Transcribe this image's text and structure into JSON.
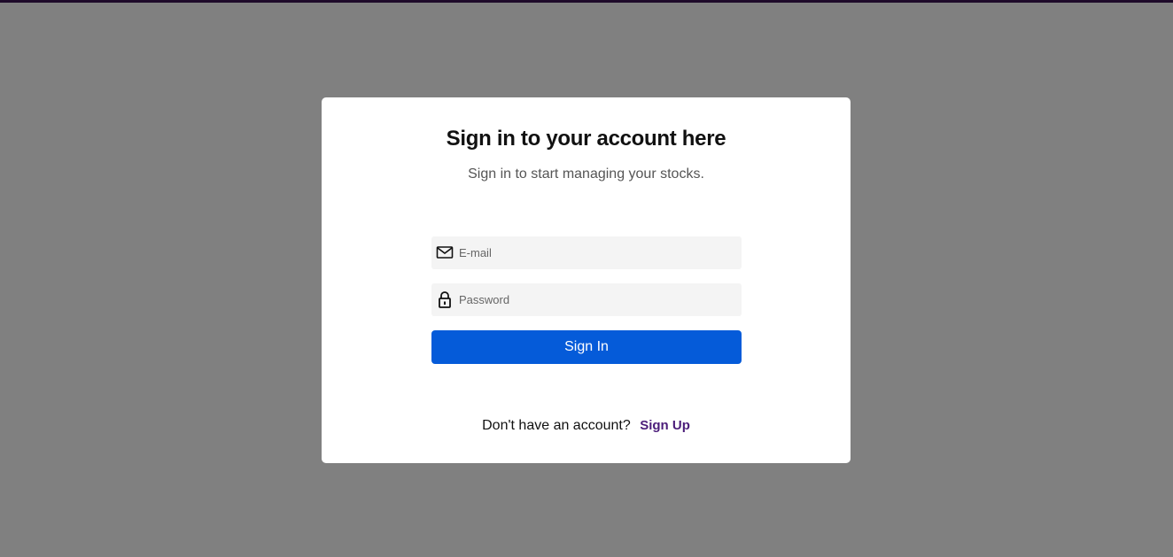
{
  "colors": {
    "page_background": "#808080",
    "top_strip": "#1e0a2a",
    "modal_background": "#ffffff",
    "input_background": "#f4f4f4",
    "primary_button": "#055bd9",
    "link": "#4b1d7a"
  },
  "signin": {
    "title": "Sign in to your account here",
    "subtitle": "Sign in to start managing your stocks.",
    "email": {
      "icon": "mail-icon",
      "placeholder": "E-mail",
      "value": ""
    },
    "password": {
      "icon": "lock-icon",
      "placeholder": "Password",
      "value": ""
    },
    "submit_label": "Sign In",
    "footer": {
      "prompt": "Don't have an account?",
      "link_label": "Sign Up"
    }
  }
}
